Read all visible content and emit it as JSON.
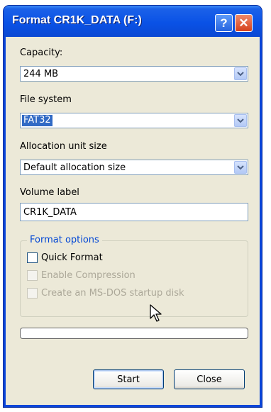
{
  "window": {
    "title": "Format CR1K_DATA (F:)",
    "help_label": "?",
    "close_label": "✕"
  },
  "capacity": {
    "label": "Capacity:",
    "value": "244 MB"
  },
  "file_system": {
    "label": "File system",
    "value": "FAT32"
  },
  "allocation": {
    "label": "Allocation unit size",
    "value": "Default allocation size"
  },
  "volume": {
    "label": "Volume label",
    "value": "CR1K_DATA"
  },
  "format_options": {
    "title": "Format options",
    "quick_format": "Quick Format",
    "enable_compression": "Enable Compression",
    "msdos_startup": "Create an MS-DOS startup disk"
  },
  "progress": {
    "value": 0
  },
  "buttons": {
    "start": "Start",
    "close": "Close"
  },
  "colors": {
    "titlebar": "#0a52e6",
    "client_bg": "#ece9d8",
    "selection": "#316ac5",
    "group_title": "#0046d5",
    "close_button": "#d5411c"
  }
}
